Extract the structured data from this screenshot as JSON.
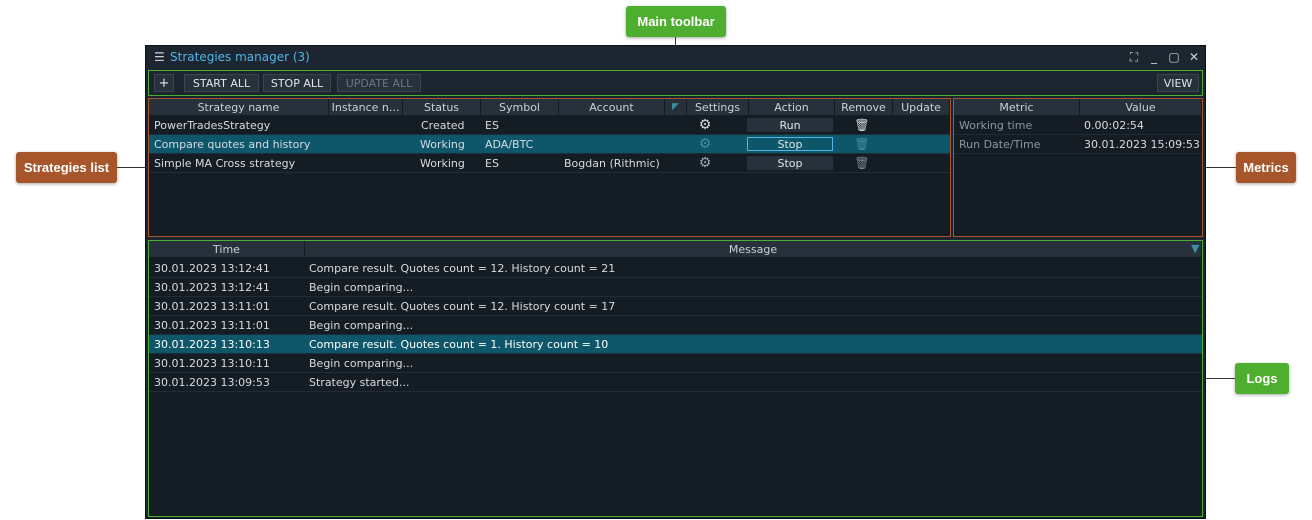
{
  "callouts": {
    "main_toolbar": "Main toolbar",
    "strategies_list": "Strategies list",
    "metrics": "Metrics",
    "logs": "Logs"
  },
  "window": {
    "menu_icon": "☰",
    "title": "Strategies manager (3)",
    "controls": [
      "⛶",
      "_",
      "▢",
      "✕"
    ]
  },
  "toolbar": {
    "add_label": "+",
    "start_all": "START ALL",
    "stop_all": "STOP ALL",
    "update_all": "UPDATE ALL",
    "view": "VIEW"
  },
  "strategies": {
    "columns": [
      "Strategy name",
      "Instance n...",
      "Status",
      "Symbol",
      "Account",
      "",
      "Settings",
      "Action",
      "Remove",
      "Update"
    ],
    "rows": [
      {
        "name": "PowerTradesStrategy",
        "status": "Created",
        "symbol": "ES",
        "account": "",
        "action": "Run"
      },
      {
        "name": "Compare quotes and history",
        "status": "Working",
        "symbol": "ADA/BTC",
        "account": "",
        "action": "Stop"
      },
      {
        "name": "Simple MA Cross strategy",
        "status": "Working",
        "symbol": "ES",
        "account": "Bogdan (Rithmic)",
        "action": "Stop"
      }
    ]
  },
  "metrics": {
    "columns": [
      "Metric",
      "Value"
    ],
    "rows": [
      {
        "metric": "Working time",
        "value": "0.00:02:54"
      },
      {
        "metric": "Run Date/Time",
        "value": "30.01.2023 15:09:53"
      }
    ]
  },
  "logs": {
    "columns": [
      "Time",
      "Message"
    ],
    "rows": [
      {
        "time": "30.01.2023 13:12:41",
        "message": "Compare result. Quotes count = 12. History count = 21"
      },
      {
        "time": "30.01.2023 13:12:41",
        "message": "Begin comparing..."
      },
      {
        "time": "30.01.2023 13:11:01",
        "message": "Compare result. Quotes count = 12. History count = 17"
      },
      {
        "time": "30.01.2023 13:11:01",
        "message": "Begin comparing..."
      },
      {
        "time": "30.01.2023 13:10:13",
        "message": "Compare result. Quotes count = 1. History count = 10"
      },
      {
        "time": "30.01.2023 13:10:11",
        "message": "Begin comparing..."
      },
      {
        "time": "30.01.2023 13:09:53",
        "message": "Strategy started..."
      }
    ]
  },
  "icons": {
    "settings": "gear-icon",
    "remove": "trash-icon",
    "filter": "filter-icon"
  },
  "colors": {
    "green": "#4dae2f",
    "brown": "#a6562a",
    "accent": "#4fb5e8",
    "selected": "#0e5669"
  }
}
